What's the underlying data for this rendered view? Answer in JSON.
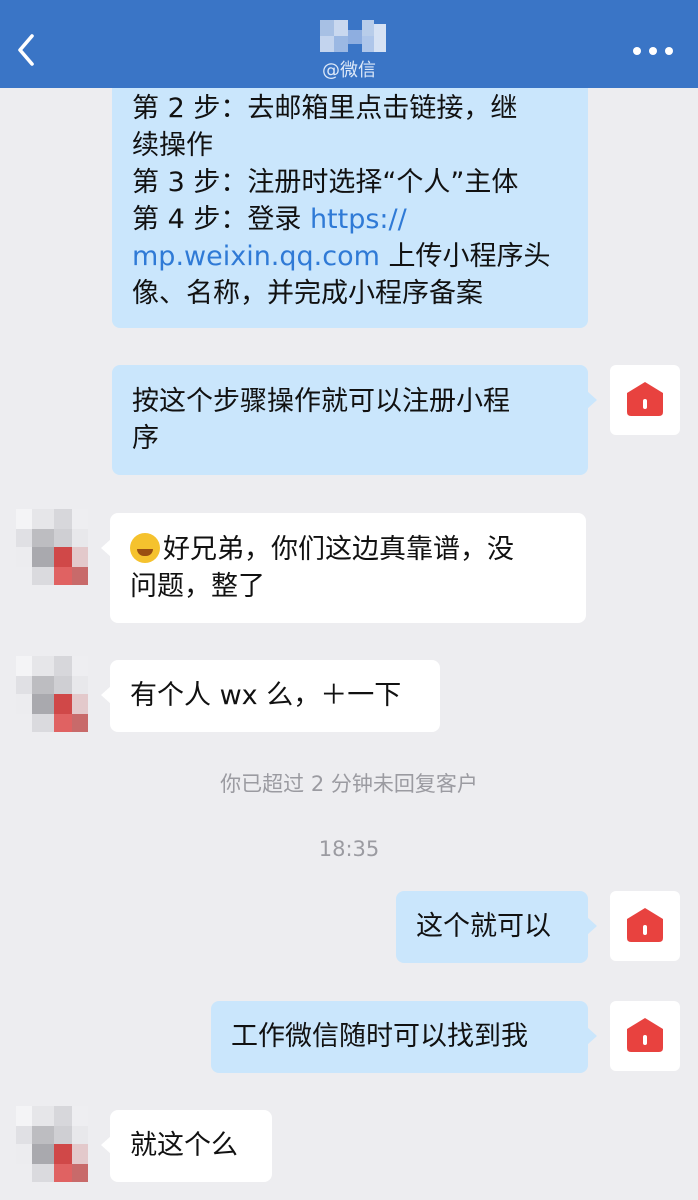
{
  "header": {
    "subtitle": "@微信",
    "back_icon": "chevron-left-icon",
    "more_icon": "more-dots-icon",
    "bg_color": "#3a75c6"
  },
  "messages": [
    {
      "sender": "me",
      "lines": [
        "第 2 步：去邮箱里点击链接，继",
        "续操作",
        "第 3 步：注册时选择“个人”主体",
        "第 4 步：登录 "
      ],
      "link": "https://",
      "link2": "mp.weixin.qq.com",
      "after_link": " 上传小程序头",
      "last_line": "像、名称，并完成小程序备案"
    },
    {
      "sender": "me",
      "lines": [
        "按这个步骤操作就可以注册小程",
        "序"
      ]
    },
    {
      "sender": "customer",
      "emoji": "laughing-crying-emoji",
      "lines": [
        "好兄弟，你们这边真靠谱，没",
        "问题，整了"
      ]
    },
    {
      "sender": "customer",
      "lines": [
        "有个人 wx 么，＋一下"
      ]
    },
    {
      "sender": "me",
      "lines": [
        "这个就可以"
      ]
    },
    {
      "sender": "me",
      "lines": [
        "工作微信随时可以找到我"
      ]
    },
    {
      "sender": "customer",
      "lines": [
        "就这个么"
      ]
    }
  ],
  "system_notice": "你已超过 2 分钟未回复客户",
  "timestamp": "18:35",
  "colors": {
    "outgoing_bubble": "#cae6fc",
    "incoming_bubble": "#ffffff",
    "link": "#2f7ad6",
    "avatar_icon": "#e8423f"
  }
}
